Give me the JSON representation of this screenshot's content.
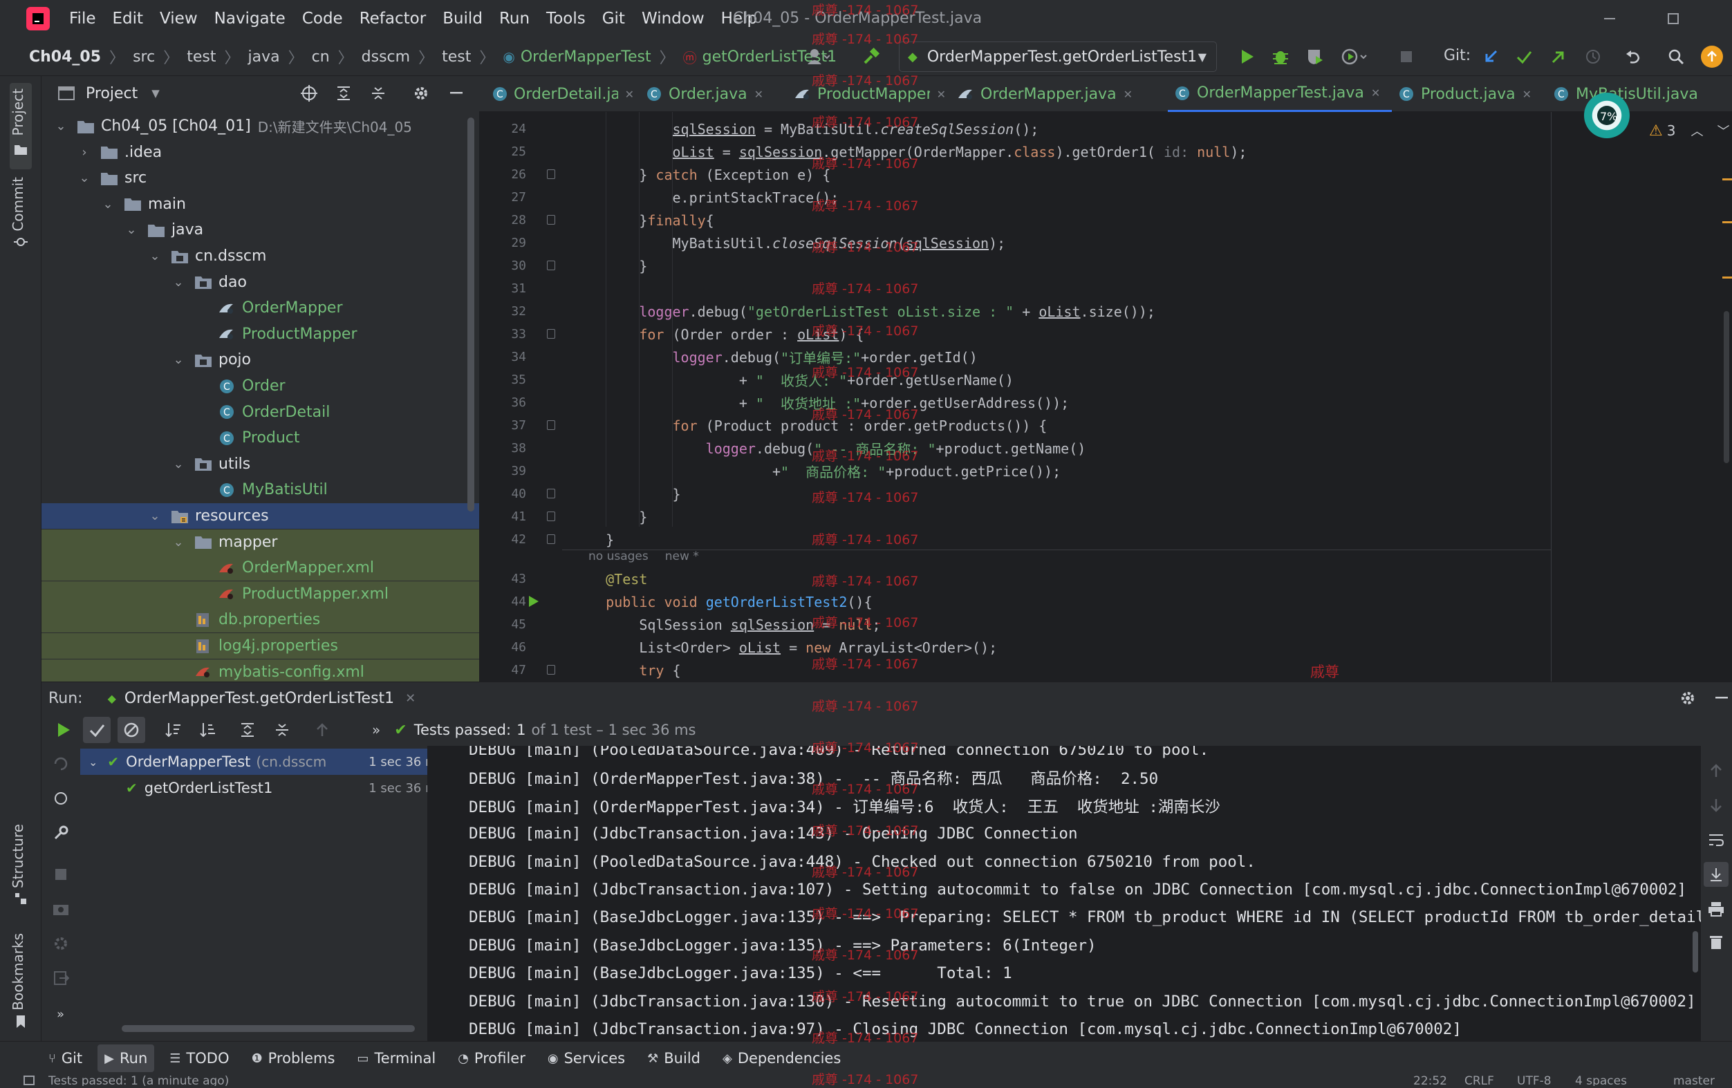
{
  "menubar": {
    "items": [
      "File",
      "Edit",
      "View",
      "Navigate",
      "Code",
      "Refactor",
      "Build",
      "Run",
      "Tools",
      "Git",
      "Window",
      "Help"
    ],
    "window_title": "Ch04_05 - OrderMapperTest.java"
  },
  "navbar": {
    "breadcrumb": [
      "Ch04_05",
      "src",
      "test",
      "java",
      "cn",
      "dsscm",
      "test",
      "OrderMapperTest",
      "getOrderListTest1"
    ],
    "run_config": "OrderMapperTest.getOrderListTest1",
    "git_label": "Git:"
  },
  "left_stripe": {
    "project": "Project",
    "commit": "Commit",
    "structure": "Structure",
    "bookmarks": "Bookmarks"
  },
  "project_panel": {
    "title": "Project",
    "tree": [
      {
        "label": "Ch04_05 [Ch04_01]",
        "extra": "D:\\新建文件夹\\Ch04_05",
        "depth": 0,
        "icon": "folder-icon",
        "open": true
      },
      {
        "label": ".idea",
        "depth": 1,
        "icon": "folder-icon",
        "open": false
      },
      {
        "label": "src",
        "depth": 1,
        "icon": "folder-icon",
        "open": true
      },
      {
        "label": "main",
        "depth": 2,
        "icon": "folder-icon",
        "open": true
      },
      {
        "label": "java",
        "depth": 3,
        "icon": "folder-icon",
        "open": true
      },
      {
        "label": "cn.dsscm",
        "depth": 4,
        "icon": "package-icon",
        "open": true
      },
      {
        "label": "dao",
        "depth": 5,
        "icon": "package-icon",
        "open": true
      },
      {
        "label": "OrderMapper",
        "depth": 6,
        "icon": "mybatis-icon",
        "leaf": true
      },
      {
        "label": "ProductMapper",
        "depth": 6,
        "icon": "mybatis-icon",
        "leaf": true
      },
      {
        "label": "pojo",
        "depth": 5,
        "icon": "package-icon",
        "open": true
      },
      {
        "label": "Order",
        "depth": 6,
        "icon": "class-icon",
        "leaf": true
      },
      {
        "label": "OrderDetail",
        "depth": 6,
        "icon": "class-icon",
        "leaf": true
      },
      {
        "label": "Product",
        "depth": 6,
        "icon": "class-icon",
        "leaf": true
      },
      {
        "label": "utils",
        "depth": 5,
        "icon": "package-icon",
        "open": true
      },
      {
        "label": "MyBatisUtil",
        "depth": 6,
        "icon": "class-icon",
        "leaf": true
      },
      {
        "label": "resources",
        "depth": 4,
        "icon": "resources-folder-icon",
        "open": true,
        "selected": true
      },
      {
        "label": "mapper",
        "depth": 5,
        "icon": "folder-icon",
        "open": true
      },
      {
        "label": "OrderMapper.xml",
        "depth": 6,
        "icon": "xml-icon",
        "leaf": true
      },
      {
        "label": "ProductMapper.xml",
        "depth": 6,
        "icon": "xml-icon",
        "leaf": true
      },
      {
        "label": "db.properties",
        "depth": 5,
        "icon": "properties-icon",
        "leaf": true
      },
      {
        "label": "log4j.properties",
        "depth": 5,
        "icon": "properties-icon",
        "leaf": true
      },
      {
        "label": "mybatis-config.xml",
        "depth": 5,
        "icon": "xml-icon",
        "leaf": true
      }
    ]
  },
  "editor": {
    "tabs": [
      "OrderDetail.java",
      "Order.java",
      "ProductMapper.java",
      "OrderMapper.java",
      "OrderMapperTest.java",
      "Product.java",
      "MyBatisUtil.java"
    ],
    "active_tab": "OrderMapperTest.java",
    "warnings": "3",
    "inlay_usages": "no usages",
    "inlay_new": "new *",
    "watermark_text": "戚尊 -174 - 1067",
    "watermark_short": "戚尊",
    "line_numbers": [
      "24",
      "25",
      "26",
      "27",
      "28",
      "29",
      "30",
      "31",
      "32",
      "33",
      "34",
      "35",
      "36",
      "37",
      "38",
      "39",
      "40",
      "41",
      "42",
      "",
      "43",
      "44",
      "45",
      "46",
      "47"
    ],
    "lines": [
      [
        {
          "t": "            "
        },
        {
          "t": "sqlSession",
          "c": "ul"
        },
        {
          "t": " = MyBatisUtil."
        },
        {
          "t": "createSqlSession",
          "c": "it"
        },
        {
          "t": "();"
        }
      ],
      [
        {
          "t": "            "
        },
        {
          "t": "oList",
          "c": "ul"
        },
        {
          "t": " = "
        },
        {
          "t": "sqlSession",
          "c": "ul"
        },
        {
          "t": ".getMapper(OrderMapper."
        },
        {
          "t": "class",
          "c": "kw"
        },
        {
          "t": ").getOrder1( "
        },
        {
          "t": "id:",
          "c": "cmt"
        },
        {
          "t": " "
        },
        {
          "t": "null",
          "c": "kw"
        },
        {
          "t": ");"
        }
      ],
      [
        {
          "t": "        } "
        },
        {
          "t": "catch",
          "c": "kw"
        },
        {
          "t": " (Exception e) {"
        }
      ],
      [
        {
          "t": "            e.printStackTrace();"
        }
      ],
      [
        {
          "t": "        }"
        },
        {
          "t": "finally",
          "c": "kw"
        },
        {
          "t": "{"
        }
      ],
      [
        {
          "t": "            MyBatisUtil."
        },
        {
          "t": "closeSqlSession",
          "c": "it"
        },
        {
          "t": "("
        },
        {
          "t": "sqlSession",
          "c": "ul"
        },
        {
          "t": ");"
        }
      ],
      [
        {
          "t": "        }"
        }
      ],
      [
        {
          "t": ""
        }
      ],
      [
        {
          "t": "        "
        },
        {
          "t": "logger",
          "c": "fld"
        },
        {
          "t": ".debug("
        },
        {
          "t": "\"getOrderListTest oList.size : \"",
          "c": "str"
        },
        {
          "t": " + "
        },
        {
          "t": "oList",
          "c": "ul"
        },
        {
          "t": ".size());"
        }
      ],
      [
        {
          "t": "        "
        },
        {
          "t": "for",
          "c": "kw"
        },
        {
          "t": " (Order order : "
        },
        {
          "t": "oList",
          "c": "ul"
        },
        {
          "t": ") {"
        }
      ],
      [
        {
          "t": "            "
        },
        {
          "t": "logger",
          "c": "fld"
        },
        {
          "t": ".debug("
        },
        {
          "t": "\"订单编号:\"",
          "c": "str"
        },
        {
          "t": "+order.getId()"
        }
      ],
      [
        {
          "t": "                    + "
        },
        {
          "t": "\"  收货人: \"",
          "c": "str"
        },
        {
          "t": "+order.getUserName()"
        }
      ],
      [
        {
          "t": "                    + "
        },
        {
          "t": "\"  收货地址 :\"",
          "c": "str"
        },
        {
          "t": "+order.getUserAddress());"
        }
      ],
      [
        {
          "t": "            "
        },
        {
          "t": "for",
          "c": "kw"
        },
        {
          "t": " (Product product : order.getProducts()) {"
        }
      ],
      [
        {
          "t": "                "
        },
        {
          "t": "logger",
          "c": "fld"
        },
        {
          "t": ".debug("
        },
        {
          "t": "\" -- 商品名称: \"",
          "c": "str"
        },
        {
          "t": "+product.getName()"
        }
      ],
      [
        {
          "t": "                        +"
        },
        {
          "t": "\"  商品价格: \"",
          "c": "str"
        },
        {
          "t": "+product.getPrice());"
        }
      ],
      [
        {
          "t": "            }"
        }
      ],
      [
        {
          "t": "        }"
        }
      ],
      [
        {
          "t": "    }"
        }
      ],
      [
        {
          "t": ""
        }
      ],
      [
        {
          "t": "    "
        },
        {
          "t": "@Test",
          "c": "ann"
        }
      ],
      [
        {
          "t": "    "
        },
        {
          "t": "public",
          "c": "kw"
        },
        {
          "t": " "
        },
        {
          "t": "void",
          "c": "kw"
        },
        {
          "t": " "
        },
        {
          "t": "getOrderListTest2",
          "c": "mth"
        },
        {
          "t": "(){"
        }
      ],
      [
        {
          "t": "        SqlSession "
        },
        {
          "t": "sqlSession",
          "c": "ul"
        },
        {
          "t": " = "
        },
        {
          "t": "null",
          "c": "kw"
        },
        {
          "t": ";"
        }
      ],
      [
        {
          "t": "        List<Order> "
        },
        {
          "t": "oList",
          "c": "ul"
        },
        {
          "t": " = "
        },
        {
          "t": "new",
          "c": "kw"
        },
        {
          "t": " ArrayList<Order>();"
        }
      ],
      [
        {
          "t": "        "
        },
        {
          "t": "try",
          "c": "kw"
        },
        {
          "t": " {"
        }
      ]
    ]
  },
  "run_panel": {
    "label": "Run:",
    "config_tab": "OrderMapperTest.getOrderListTest1",
    "status_prefix": "Tests passed:",
    "status_count": "1",
    "status_rest": "of 1 test – 1 sec 36 ms",
    "tree": [
      {
        "name": "OrderMapperTest",
        "pkg": "(cn.dsscm",
        "time": "1 sec 36 ms"
      },
      {
        "name": "getOrderListTest1",
        "pkg": "",
        "time": "1 sec 36 ms"
      }
    ],
    "log": [
      "DEBUG [main] (PooledDataSource.java:409) - Returned connection 6750210 to pool.",
      "DEBUG [main] (OrderMapperTest.java:38) -  -- 商品名称: 西瓜   商品价格:  2.50",
      "DEBUG [main] (OrderMapperTest.java:34) - 订单编号:6  收货人:  王五  收货地址 :湖南长沙",
      "DEBUG [main] (JdbcTransaction.java:143) - Opening JDBC Connection",
      "DEBUG [main] (PooledDataSource.java:448) - Checked out connection 6750210 from pool.",
      "DEBUG [main] (JdbcTransaction.java:107) - Setting autocommit to false on JDBC Connection [com.mysql.cj.jdbc.ConnectionImpl@670002]",
      "DEBUG [main] (BaseJdbcLogger.java:135) - ==>  Preparing: SELECT * FROM tb_product WHERE id IN (SELECT productId FROM tb_order_detail",
      "DEBUG [main] (BaseJdbcLogger.java:135) - ==> Parameters: 6(Integer)",
      "DEBUG [main] (BaseJdbcLogger.java:135) - <==      Total: 1",
      "DEBUG [main] (JdbcTransaction.java:130) - Resetting autocommit to true on JDBC Connection [com.mysql.cj.jdbc.ConnectionImpl@670002]",
      "DEBUG [main] (JdbcTransaction.java:97) - Closing JDBC Connection [com.mysql.cj.jdbc.ConnectionImpl@670002]"
    ]
  },
  "bottom_tabs": [
    "Git",
    "Run",
    "TODO",
    "Problems",
    "Terminal",
    "Profiler",
    "Services",
    "Build",
    "Dependencies"
  ],
  "status_bar": {
    "left": "Tests passed: 1 (a minute ago)",
    "time": "22:52",
    "line_sep": "CRLF",
    "encoding": "UTF-8",
    "indent": "4 spaces",
    "branch": "master"
  },
  "colors": {
    "accent": "#3574f0",
    "green": "#5fb832",
    "selection": "#2e436e",
    "resources_bg": "#4a5639",
    "text_green": "#73bd79"
  }
}
